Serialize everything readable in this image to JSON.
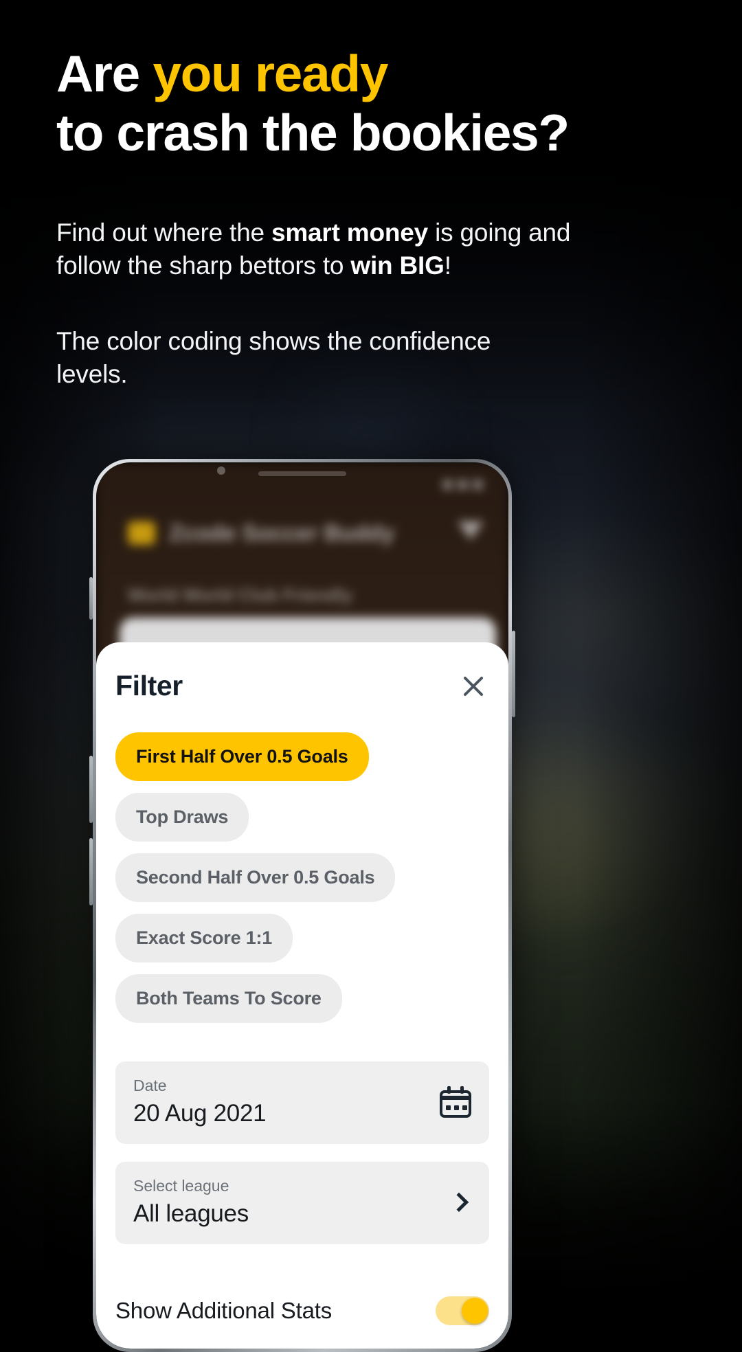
{
  "promo": {
    "headline_line1_white": "Are ",
    "headline_line1_accent": "you ready",
    "headline_line2": "to crash the bookies?",
    "paragraph1_part1": "Find out where the ",
    "paragraph1_bold1": "smart money",
    "paragraph1_part2": " is going and follow the sharp bettors to ",
    "paragraph1_bold2": "win BIG",
    "paragraph1_part3": "!",
    "paragraph2": "The color coding shows the confidence levels."
  },
  "colors": {
    "accent": "#FFC400",
    "chip_inactive_bg": "#ECECEC",
    "sheet_bg": "#FFFFFF",
    "field_bg": "#EFEFEF",
    "background": "#000000"
  },
  "phone": {
    "app": {
      "title": "Zcode Soccer Buddy",
      "league_header": "World World Club Friendly",
      "logo_icon": "app-logo-icon",
      "filter_icon": "funnel-icon",
      "status_icons": [
        "signal-icon",
        "wifi-icon",
        "battery-icon"
      ]
    },
    "sheet": {
      "title": "Filter",
      "close_icon": "close-icon",
      "chips": [
        {
          "label": "First Half Over 0.5 Goals",
          "active": true
        },
        {
          "label": "Top Draws",
          "active": false
        },
        {
          "label": "Second Half Over 0.5 Goals",
          "active": false
        },
        {
          "label": "Exact Score 1:1",
          "active": false
        },
        {
          "label": "Both Teams To Score",
          "active": false
        }
      ],
      "date_field": {
        "label": "Date",
        "value": "20 Aug 2021",
        "icon": "calendar-icon"
      },
      "league_field": {
        "label": "Select league",
        "value": "All leagues",
        "icon": "chevron-right-icon"
      },
      "additional_stats": {
        "label": "Show Additional Stats",
        "enabled": true
      }
    }
  }
}
